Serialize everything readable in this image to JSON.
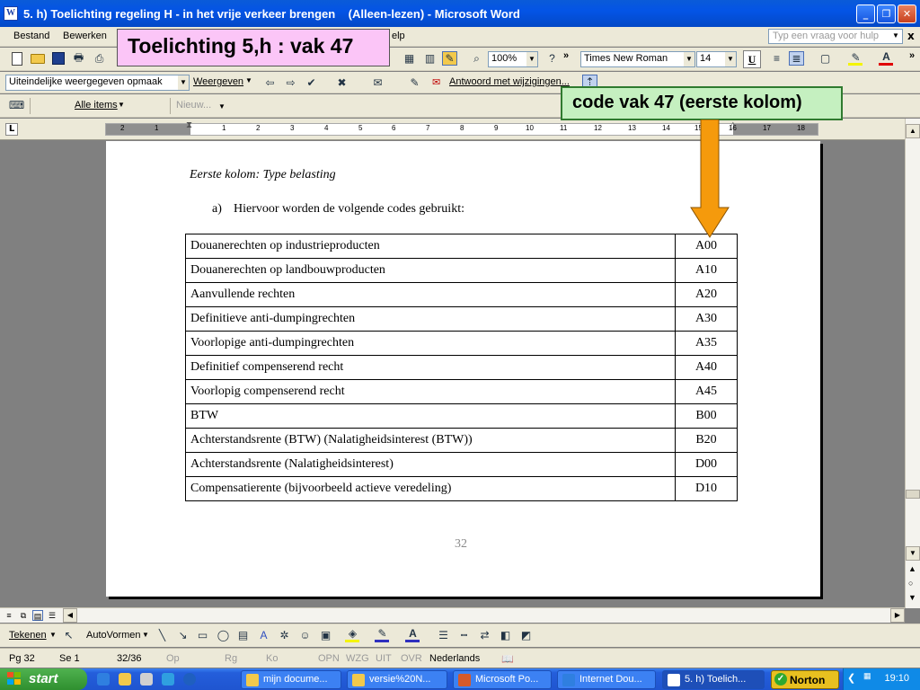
{
  "window": {
    "title": "5. h) Toelichting regeling H - in het vrije verkeer brengen    (Alleen-lezen) - Microsoft Word",
    "buttons": [
      "_",
      "❐",
      "✕"
    ]
  },
  "menu": {
    "items": [
      "Bestand",
      "Bewerken",
      "elp"
    ],
    "help_placeholder": "Typ een vraag voor hulp",
    "close": "x"
  },
  "toolbar_standard": {
    "zoom": "100%",
    "font": "Times New Roman",
    "font_size": "14",
    "chevron": "»"
  },
  "toolbar_review": {
    "display_mode": "Uiteindelijke weergegeven opmaak",
    "show_label": "Weergeven",
    "reply_label": "Antwoord met wijzigingen..."
  },
  "toolbar_web": {
    "items_label": "Alle items",
    "new_label": "Nieuw..."
  },
  "ruler": {
    "tab_marker": "L",
    "numbers": [
      "2",
      "1",
      "1",
      "2",
      "3",
      "4",
      "5",
      "6",
      "7",
      "8",
      "9",
      "10",
      "11",
      "12",
      "13",
      "14",
      "15",
      "16",
      "17",
      "18"
    ]
  },
  "document": {
    "heading": "Eerste kolom: Type belasting",
    "list_marker": "a)",
    "intro": "Hiervoor worden de volgende codes gebruikt:",
    "rows": [
      {
        "label": "Douanerechten op industrieproducten",
        "code": "A00"
      },
      {
        "label": "Douanerechten op landbouwproducten",
        "code": "A10"
      },
      {
        "label": "Aanvullende rechten",
        "code": "A20"
      },
      {
        "label": "Definitieve anti-dumpingrechten",
        "code": "A30"
      },
      {
        "label": "Voorlopige anti-dumpingrechten",
        "code": "A35"
      },
      {
        "label": "Definitief compenserend recht",
        "code": "A40"
      },
      {
        "label": "Voorlopig compenserend recht",
        "code": "A45"
      },
      {
        "label": "BTW",
        "code": "B00"
      },
      {
        "label": "Achterstandsrente (BTW) (Nalatigheidsinterest (BTW))",
        "code": "B20"
      },
      {
        "label": "Achterstandsrente (Nalatigheidsinterest)",
        "code": "D00"
      },
      {
        "label": "Compensatierente (bijvoorbeeld actieve veredeling)",
        "code": "D10"
      }
    ],
    "page_number": "32"
  },
  "drawing_toolbar": {
    "draw_label": "Tekenen",
    "autoshapes_label": "AutoVormen"
  },
  "status": {
    "page": "Pg 32",
    "section": "Se 1",
    "pages": "32/36",
    "at": "Op",
    "line": "Rg",
    "col": "Ko",
    "rec": "OPN",
    "trk": "WZG",
    "ext": "UIT",
    "ovr": "OVR",
    "language": "Nederlands"
  },
  "taskbar": {
    "start": "start",
    "tasks": [
      {
        "label": "mijn docume...",
        "color": "#f2c94c"
      },
      {
        "label": "versie%20N...",
        "color": "#f2c94c"
      },
      {
        "label": "Microsoft Po...",
        "color": "#d65a2a"
      },
      {
        "label": "Internet Dou...",
        "color": "#2f7fe0"
      },
      {
        "label": "5. h) Toelich...",
        "color": "#ffffff"
      }
    ],
    "norton": "Norton",
    "clock": "19:10"
  },
  "callouts": {
    "title": "Toelichting 5,h : vak 47",
    "code": "code vak 47 (eerste kolom)"
  },
  "colors": {
    "callout_title_bg": "#fbc5f7",
    "callout_code_bg": "#c5f0c0",
    "arrow": "#f59a0c",
    "titlebar": "#0454e6"
  }
}
